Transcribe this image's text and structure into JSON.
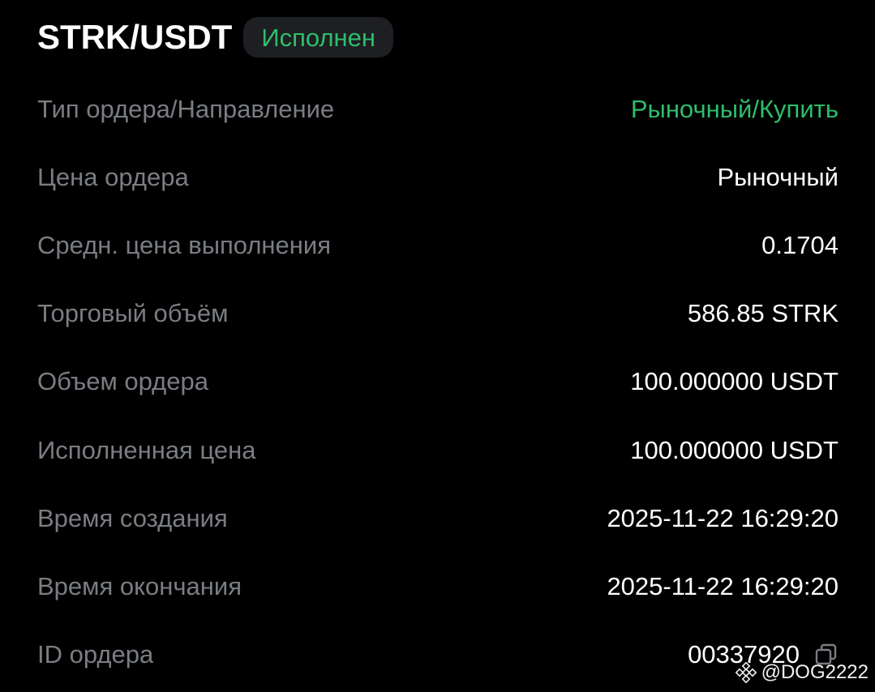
{
  "header": {
    "pair": "STRK/USDT",
    "status": "Исполнен"
  },
  "colors": {
    "accent_green": "#2ebd6b",
    "label_gray": "#7a7d82",
    "background": "#000000",
    "badge_bg": "#1d1f22"
  },
  "details": [
    {
      "label": "Тип ордера/Направление",
      "value": "Рыночный/Купить"
    },
    {
      "label": "Цена ордера",
      "value": "Рыночный"
    },
    {
      "label": "Средн. цена выполнения",
      "value": "0.1704"
    },
    {
      "label": "Торговый объём",
      "value": "586.85 STRK"
    },
    {
      "label": "Объем ордера",
      "value": "100.000000 USDT"
    },
    {
      "label": "Исполненная цена",
      "value": "100.000000 USDT"
    },
    {
      "label": "Время создания",
      "value": "2025-11-22 16:29:20"
    },
    {
      "label": "Время окончания",
      "value": "2025-11-22 16:29:20"
    },
    {
      "label": "ID ордера",
      "value": "00337920"
    }
  ],
  "watermark": {
    "text": "@DOG2222",
    "icon": "binance-logo-icon"
  },
  "icons": {
    "copy": "copy-icon"
  }
}
